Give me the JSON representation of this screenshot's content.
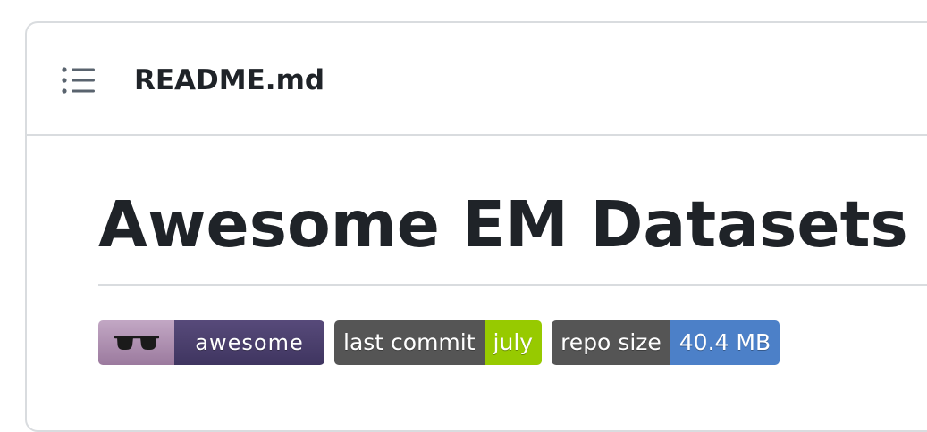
{
  "readme": {
    "outline_icon": "list-unordered-icon",
    "file_name": "README.md"
  },
  "content": {
    "heading": "Awesome EM Datasets",
    "badges": [
      {
        "icon": "sunglasses-icon",
        "message": "awesome",
        "colors": {
          "left": "#b08fb3",
          "right": "#4b4070"
        }
      },
      {
        "label": "last commit",
        "message": "july",
        "colors": {
          "left": "#555555",
          "right": "#97ca00"
        }
      },
      {
        "label": "repo size",
        "message": "40.4 MB",
        "colors": {
          "left": "#555555",
          "right": "#4c80c8"
        }
      }
    ]
  }
}
